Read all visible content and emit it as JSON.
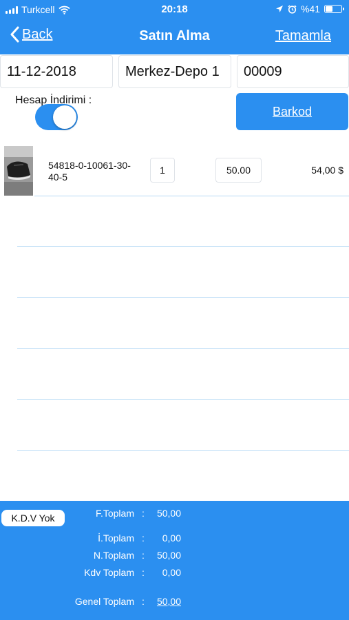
{
  "status_bar": {
    "carrier": "Turkcell",
    "time": "20:18",
    "battery": "%41"
  },
  "nav": {
    "back_label": "Back",
    "title": "Satın Alma",
    "done_label": "Tamamla"
  },
  "form": {
    "date": "11-12-2018",
    "warehouse": "Merkez-Depo 1",
    "document_no": "00009",
    "account_discount_label": "Hesap İndirimi :",
    "account_discount_on": true,
    "barcode_button": "Barkod"
  },
  "items": [
    {
      "code": "54818-0-10061-30-40-5",
      "quantity": "1",
      "unit_price": "50.00",
      "line_total": "54,00 $"
    }
  ],
  "totals": {
    "kdv_button": "K.D.V Yok",
    "rows": [
      {
        "label": "F.Toplam",
        "value": "50,00"
      },
      {
        "label": "İ.Toplam",
        "value": "0,00"
      },
      {
        "label": "N.Toplam",
        "value": "50,00"
      },
      {
        "label": "Kdv Toplam",
        "value": "0,00"
      }
    ],
    "grand": {
      "label": "Genel Toplam",
      "value": "50,00"
    },
    "separator": ":"
  },
  "colors": {
    "primary": "#2b8ff0",
    "divider": "#b7daf5"
  }
}
